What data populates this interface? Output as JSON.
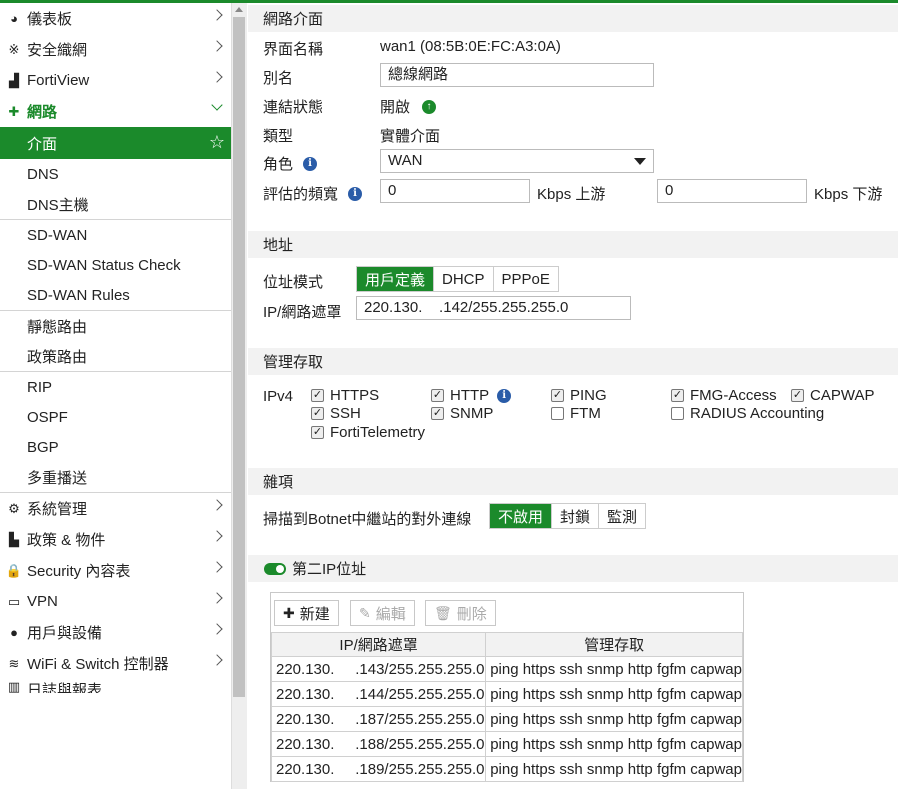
{
  "sidebar": {
    "items_top": [
      {
        "label": "儀表板",
        "icon": "dashboard-icon",
        "glyph": "◕"
      },
      {
        "label": "安全織網",
        "icon": "security-fabric-icon",
        "glyph": "※"
      },
      {
        "label": "FortiView",
        "icon": "fortiview-icon",
        "glyph": "▟"
      }
    ],
    "network": {
      "label": "網路",
      "icon": "network-icon",
      "glyph": "✚"
    },
    "network_sub": [
      {
        "label": "介面",
        "active": true
      },
      {
        "label": "DNS"
      },
      {
        "label": "DNS主機"
      },
      {
        "label": "SD-WAN"
      },
      {
        "label": "SD-WAN Status Check"
      },
      {
        "label": "SD-WAN Rules"
      },
      {
        "label": "靜態路由"
      },
      {
        "label": "政策路由"
      },
      {
        "label": "RIP"
      },
      {
        "label": "OSPF"
      },
      {
        "label": "BGP"
      },
      {
        "label": "多重播送"
      }
    ],
    "items_bottom": [
      {
        "label": "系統管理",
        "icon": "gear-icon",
        "glyph": "⚙"
      },
      {
        "label": "政策 & 物件",
        "icon": "policy-icon",
        "glyph": "▙"
      },
      {
        "label": "Security 內容表",
        "icon": "lock-icon",
        "glyph": "🔒"
      },
      {
        "label": "VPN",
        "icon": "monitor-icon",
        "glyph": "▭"
      },
      {
        "label": "用戶與設備",
        "icon": "user-icon",
        "glyph": "●"
      },
      {
        "label": "WiFi & Switch 控制器",
        "icon": "wifi-icon",
        "glyph": "≋"
      },
      {
        "label": "日誌與報表",
        "icon": "log-icon",
        "glyph": "▥"
      }
    ]
  },
  "interface": {
    "section_title": "網路介面",
    "name_label": "界面名稱",
    "name_value": "wan1 (08:5B:0E:FC:A3:0A)",
    "alias_label": "別名",
    "alias_value": "總線網路",
    "link_label": "連結狀態",
    "link_value": "開啟",
    "type_label": "類型",
    "type_value": "實體介面",
    "role_label": "角色",
    "role_value": "WAN",
    "bw_label": "評估的頻寬",
    "bw_up_value": "0",
    "bw_up_unit": "Kbps 上游",
    "bw_down_value": "0",
    "bw_down_unit": "Kbps 下游"
  },
  "address": {
    "section_title": "地址",
    "mode_label": "位址模式",
    "modes": [
      "用戶定義",
      "DHCP",
      "PPPoE"
    ],
    "ip_label": "IP/網路遮罩",
    "ip_value": "220.130.    .142/255.255.255.0"
  },
  "admin": {
    "section_title": "管理存取",
    "ipv4_label": "IPv4",
    "options": [
      {
        "label": "HTTPS",
        "checked": true
      },
      {
        "label": "HTTP",
        "checked": true
      },
      {
        "label": "PING",
        "checked": true
      },
      {
        "label": "FMG-Access",
        "checked": true
      },
      {
        "label": "CAPWAP",
        "checked": true
      },
      {
        "label": "SSH",
        "checked": true
      },
      {
        "label": "SNMP",
        "checked": true
      },
      {
        "label": "FTM",
        "checked": false
      },
      {
        "label": "RADIUS Accounting",
        "checked": false
      },
      {
        "label": "FortiTelemetry",
        "checked": true
      }
    ]
  },
  "misc": {
    "section_title": "雜項",
    "botnet_label": "掃描到Botnet中繼站的對外連線",
    "botnet_options": [
      "不啟用",
      "封鎖",
      "監測"
    ]
  },
  "secondary": {
    "title": "第二IP位址",
    "new_label": "新建",
    "edit_label": "編輯",
    "delete_label": "刪除",
    "columns": [
      "IP/網路遮罩",
      "管理存取"
    ],
    "rows": [
      [
        "220.130.     .143/255.255.255.0",
        "ping https ssh snmp http fgfm capwap"
      ],
      [
        "220.130.     .144/255.255.255.0",
        "ping https ssh snmp http fgfm capwap"
      ],
      [
        "220.130.     .187/255.255.255.0",
        "ping https ssh snmp http fgfm capwap"
      ],
      [
        "220.130.     .188/255.255.255.0",
        "ping https ssh snmp http fgfm capwap"
      ],
      [
        "220.130.     .189/255.255.255.0",
        "ping https ssh snmp http fgfm capwap"
      ]
    ]
  },
  "colors": {
    "accent": "#1b8a2b",
    "info": "#2a5ca8",
    "section_bg": "#f2f2f2"
  }
}
